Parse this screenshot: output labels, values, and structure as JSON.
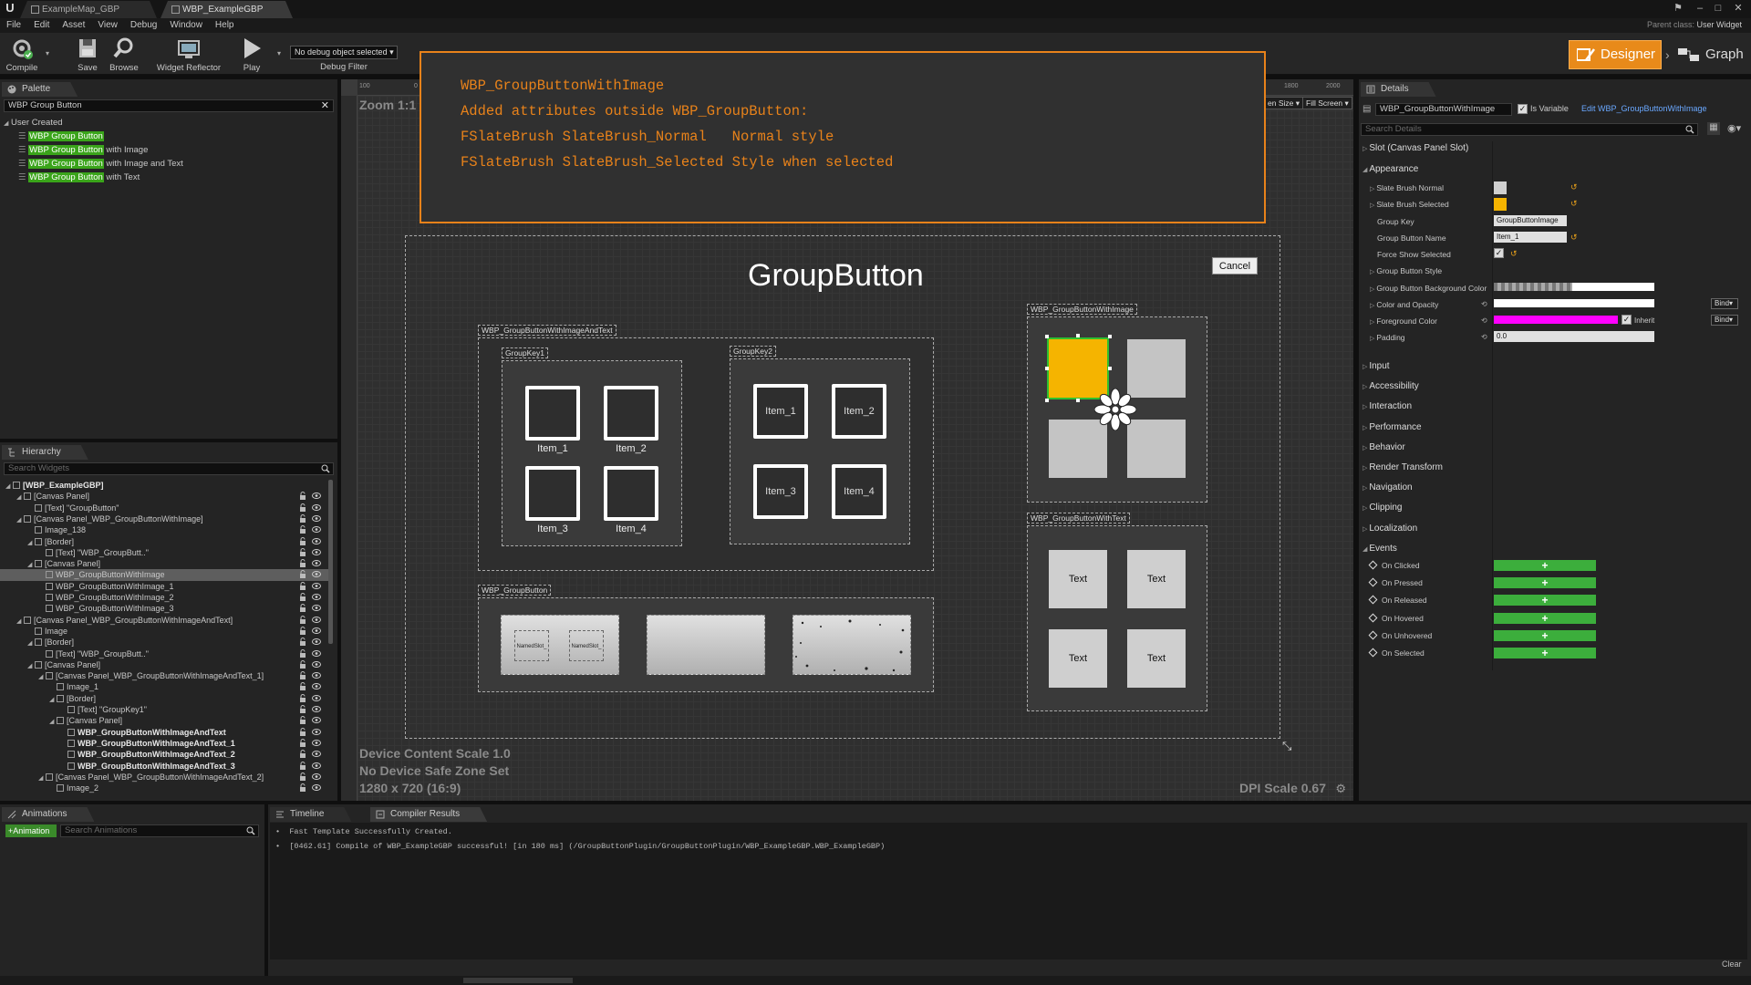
{
  "titlebar": {
    "tabs": [
      "ExampleMap_GBP",
      "WBP_ExampleGBP"
    ],
    "parent_class_label": "Parent class:",
    "parent_class_value": "User Widget"
  },
  "menu": [
    "File",
    "Edit",
    "Asset",
    "View",
    "Debug",
    "Window",
    "Help"
  ],
  "toolbar": {
    "compile": "Compile",
    "save": "Save",
    "browse": "Browse",
    "widget_reflector": "Widget Reflector",
    "play": "Play",
    "debug_select": "No debug object selected",
    "debug_filter": "Debug Filter",
    "designer": "Designer",
    "graph": "Graph"
  },
  "palette": {
    "tab": "Palette",
    "search_value": "WBP Group Button",
    "category": "User Created",
    "items": [
      {
        "hl": "WBP Group Button",
        "rest": ""
      },
      {
        "hl": "WBP Group Button",
        "rest": " with Image"
      },
      {
        "hl": "WBP Group Button",
        "rest": " with Image and Text"
      },
      {
        "hl": "WBP Group Button",
        "rest": " with Text"
      }
    ]
  },
  "hierarchy": {
    "tab": "Hierarchy",
    "search_placeholder": "Search Widgets",
    "rows": [
      "[WBP_ExampleGBP]",
      "[Canvas Panel]",
      "[Text] \"GroupButton\"",
      "[Canvas Panel_WBP_GroupButtonWithImage]",
      "Image_138",
      "[Border]",
      "[Text] \"WBP_GroupButt..\"",
      "[Canvas Panel]",
      "WBP_GroupButtonWithImage",
      "WBP_GroupButtonWithImage_1",
      "WBP_GroupButtonWithImage_2",
      "WBP_GroupButtonWithImage_3",
      "[Canvas Panel_WBP_GroupButtonWithImageAndText]",
      "Image",
      "[Border]",
      "[Text] \"WBP_GroupButt..\"",
      "[Canvas Panel]",
      "[Canvas Panel_WBP_GroupButtonWithImageAndText_1]",
      "Image_1",
      "[Border]",
      "[Text] \"GroupKey1\"",
      "[Canvas Panel]",
      "WBP_GroupButtonWithImageAndText",
      "WBP_GroupButtonWithImageAndText_1",
      "WBP_GroupButtonWithImageAndText_2",
      "WBP_GroupButtonWithImageAndText_3",
      "[Canvas Panel_WBP_GroupButtonWithImageAndText_2]",
      "Image_2"
    ]
  },
  "viewport": {
    "zoom": "Zoom 1:1",
    "ruler_labels": [
      "100",
      "0",
      "1800",
      "2000"
    ],
    "screen_size_btn": "en Size",
    "fill_screen_btn": "Fill Screen",
    "device_scale": "Device Content Scale 1.0",
    "safe_zone": "No Device Safe Zone Set",
    "resolution": "1280 x 720 (16:9)",
    "dpi": "DPI Scale 0.67"
  },
  "annotation": [
    "WBP_GroupButtonWithImage",
    "Added attributes outside WBP_GroupButton:",
    "FSlateBrush SlateBrush_Normal   Normal style",
    "FSlateBrush SlateBrush_Selected Style when selected"
  ],
  "canvas": {
    "title": "GroupButton",
    "cancel": "Cancel",
    "label_image_and_text": "WBP_GroupButtonWithImageAndText",
    "group_key_1": "GroupKey1",
    "group_key_2": "GroupKey2",
    "items": [
      "Item_1",
      "Item_2",
      "Item_3",
      "Item_4"
    ],
    "label_group_button": "WBP_GroupButton",
    "named_slot": "NamedSlot_",
    "label_with_image": "WBP_GroupButtonWithImage",
    "label_with_text": "WBP_GroupButtonWithText",
    "text_buttons": [
      "Text",
      "Text",
      "Text",
      "Text"
    ]
  },
  "details": {
    "tab": "Details",
    "name_value": "WBP_GroupButtonWithImage",
    "is_variable": "Is Variable",
    "edit_link": "Edit WBP_GroupButtonWithImage",
    "search_placeholder": "Search Details",
    "slot_section": "Slot (Canvas Panel Slot)",
    "appearance": "Appearance",
    "props": {
      "slate_brush_normal": "Slate Brush Normal",
      "slate_brush_selected": "Slate Brush Selected",
      "group_key": "Group Key",
      "group_key_value": "GroupButtonImage",
      "group_button_name": "Group Button Name",
      "group_button_name_value": "Item_1",
      "force_show_selected": "Force Show Selected",
      "group_button_style": "Group Button Style",
      "group_button_bg": "Group Button Background Color",
      "color_opacity": "Color and Opacity",
      "foreground_color": "Foreground Color",
      "inherit": "Inherit",
      "padding": "Padding",
      "padding_value": "0.0",
      "bind": "Bind"
    },
    "sections": [
      "Input",
      "Accessibility",
      "Interaction",
      "Performance",
      "Behavior",
      "Render Transform",
      "Navigation",
      "Clipping",
      "Localization"
    ],
    "events_section": "Events",
    "events": [
      "On Clicked",
      "On Pressed",
      "On Released",
      "On Hovered",
      "On Unhovered",
      "On Selected"
    ],
    "colors": {
      "selected_brush": "#f5b400",
      "foreground": "#ff00ff",
      "accent": "#e8821a",
      "event_green": "#3cae3c"
    }
  },
  "bottom": {
    "animations_tab": "Animations",
    "add_animation": "+Animation",
    "search_animations": "Search Animations",
    "timeline_tab": "Timeline",
    "compiler_tab": "Compiler Results",
    "log": [
      "Fast Template Successfully Created.",
      "[0462.61] Compile of WBP_ExampleGBP successful! [in 180 ms] (/GroupButtonPlugin/GroupButtonPlugin/WBP_ExampleGBP.WBP_ExampleGBP)"
    ],
    "clear": "Clear"
  }
}
